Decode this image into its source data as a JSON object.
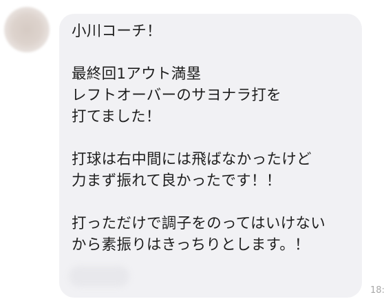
{
  "message": {
    "paragraphs": [
      [
        "小川コーチ！"
      ],
      [
        "最終回1アウト満塁",
        "レフトオーバーのサヨナラ打を",
        "打てました！"
      ],
      [
        "打球は右中間には飛ばなかったけど",
        "力まず振れて良かったです！！"
      ],
      [
        "打っただけで調子をのってはいけない",
        "から素振りはきっちりとします。！"
      ]
    ],
    "timestamp": "18:"
  },
  "colors": {
    "bubble": "#f1f1f4",
    "text": "#1e1e1e",
    "timestamp": "#a8a8a8"
  }
}
